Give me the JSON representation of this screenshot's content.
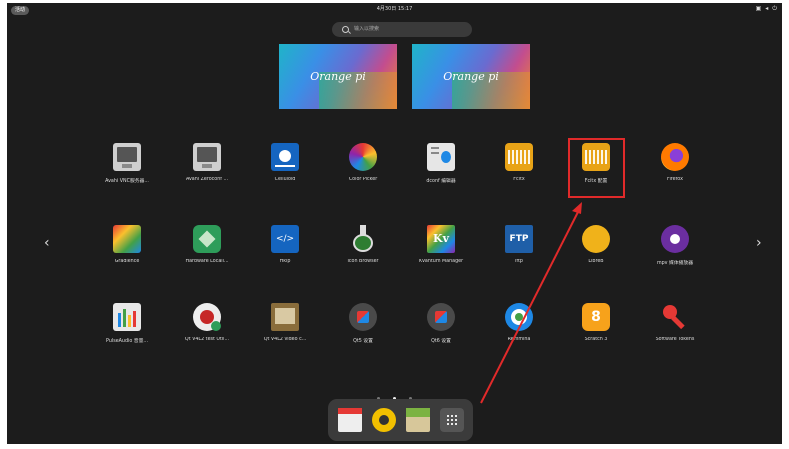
{
  "topbar": {
    "activities_label": "活动",
    "clock": "4月30日 15:17"
  },
  "search": {
    "placeholder": "输入以搜索"
  },
  "workspaces": [
    {
      "label": "Orange pi"
    },
    {
      "label": "Orange pi"
    }
  ],
  "apps": [
    {
      "label": "Avahi VNC服务器..."
    },
    {
      "label": "Avahi Zeroconf ..."
    },
    {
      "label": "Celluloid"
    },
    {
      "label": "Color Picker"
    },
    {
      "label": "dconf 编辑器"
    },
    {
      "label": "Fcitx"
    },
    {
      "label": "Fcitx 配置"
    },
    {
      "label": "Firefox"
    },
    {
      "label": "Gradience"
    },
    {
      "label": "Hardware Locali..."
    },
    {
      "label": "Hkip"
    },
    {
      "label": "Icon Browser"
    },
    {
      "label": "Kvantum Manager"
    },
    {
      "label": "lftp"
    },
    {
      "label": "LibreB"
    },
    {
      "label": "mpv 媒体播放器"
    },
    {
      "label": "PulseAudio 音量..."
    },
    {
      "label": "Qt V4L2 test Util..."
    },
    {
      "label": "Qt V4L2 video c..."
    },
    {
      "label": "Qt5 设置"
    },
    {
      "label": "Qt6 设置"
    },
    {
      "label": "Remmina"
    },
    {
      "label": "Scratch 3"
    },
    {
      "label": "Software Tokens"
    }
  ],
  "pager": {
    "current": 2,
    "total": 3
  },
  "nav": {
    "prev": "‹",
    "next": "›"
  },
  "colors": {
    "highlight": "#e12a2a",
    "arrow": "#e12a2a"
  }
}
